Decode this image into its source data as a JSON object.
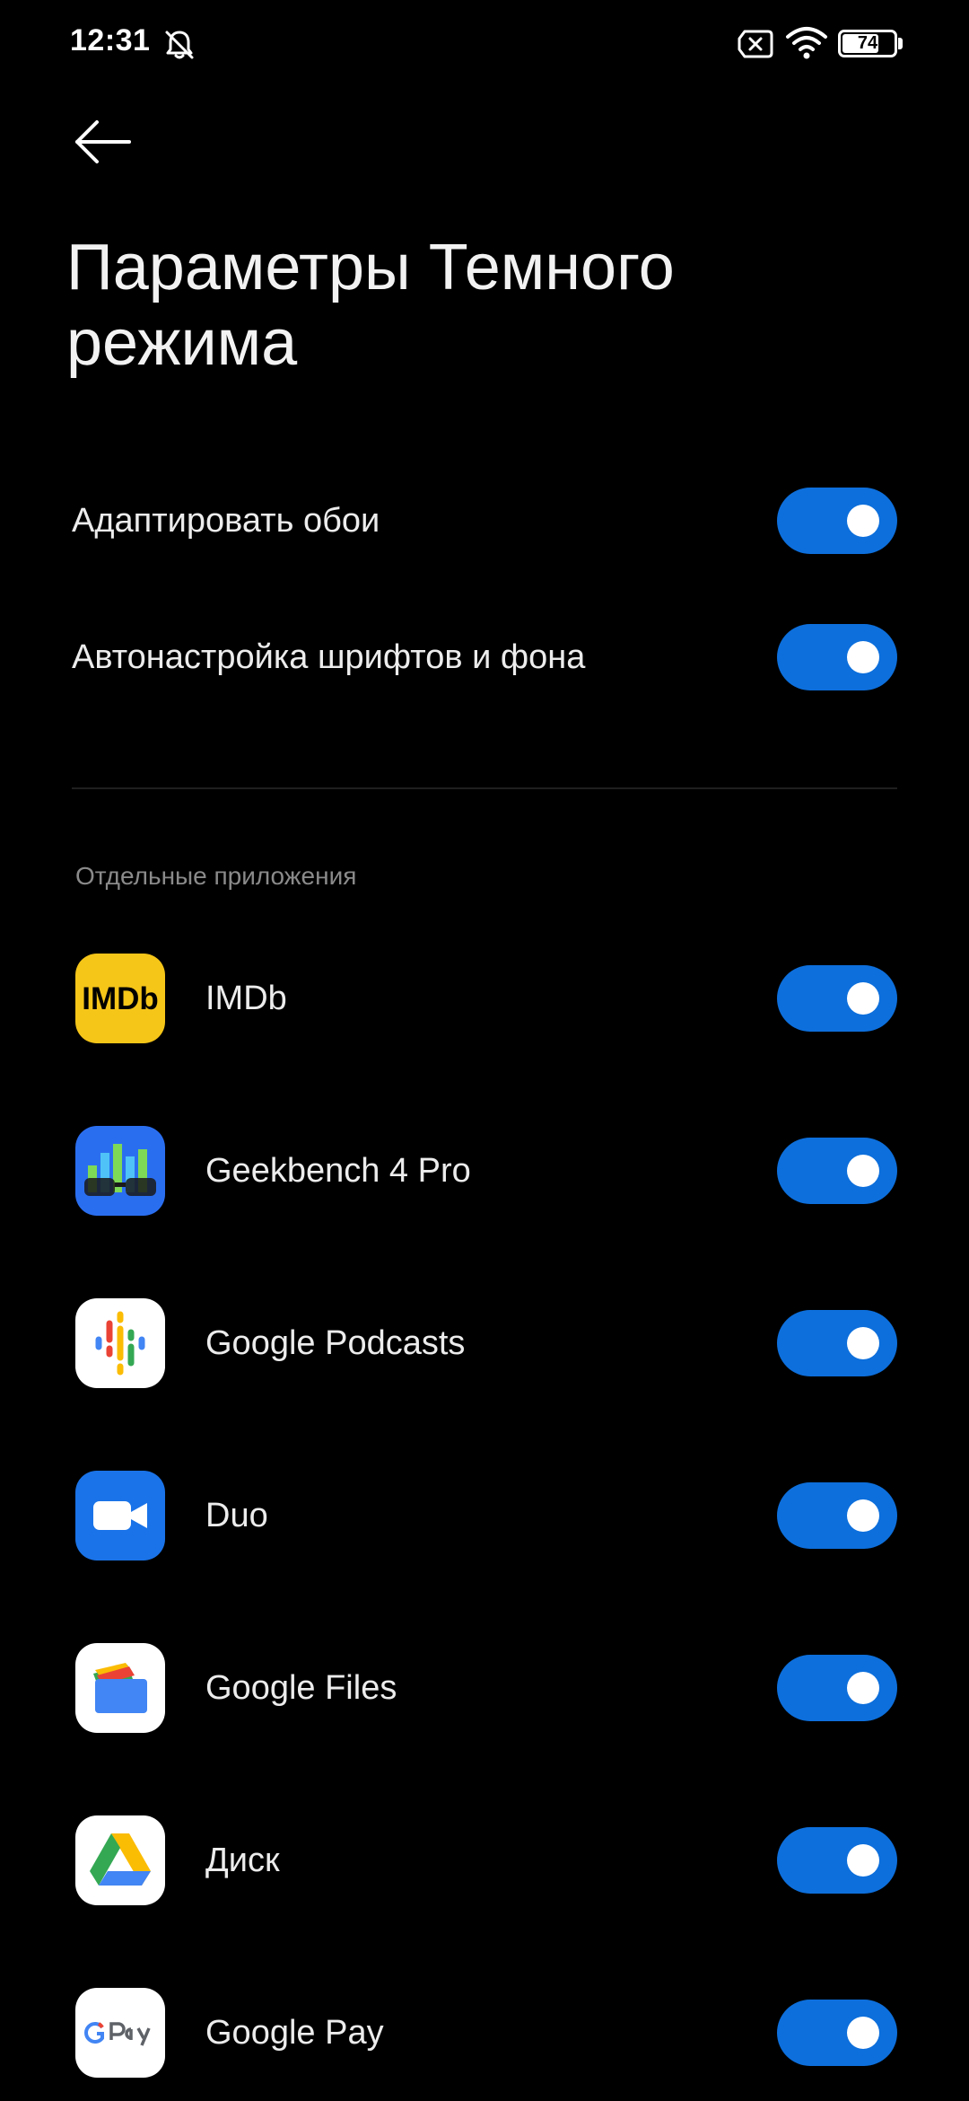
{
  "status_bar": {
    "time": "12:31",
    "battery_level": "74",
    "battery_fraction": 0.74,
    "icons": [
      "bell-muted-icon",
      "sim-none-icon",
      "wifi-icon",
      "battery-icon"
    ]
  },
  "header": {
    "back_icon": "arrow-left-icon",
    "title": "Параметры Темного режима"
  },
  "settings": [
    {
      "label": "Адаптировать обои",
      "enabled": true
    },
    {
      "label": "Автонастройка шрифтов и фона",
      "enabled": true
    }
  ],
  "section": {
    "title": "Отдельные приложения"
  },
  "apps": [
    {
      "name": "IMDb",
      "icon": "imdb-icon",
      "enabled": true
    },
    {
      "name": "Geekbench 4 Pro",
      "icon": "geekbench-icon",
      "enabled": true
    },
    {
      "name": "Google Podcasts",
      "icon": "google-podcasts-icon",
      "enabled": true
    },
    {
      "name": "Duo",
      "icon": "duo-icon",
      "enabled": true
    },
    {
      "name": "Google Files",
      "icon": "google-files-icon",
      "enabled": true
    },
    {
      "name": "Диск",
      "icon": "google-drive-icon",
      "enabled": true
    },
    {
      "name": "Google Pay",
      "icon": "google-pay-icon",
      "enabled": true
    }
  ],
  "colors": {
    "background": "#000000",
    "toggle_on": "#0d6fdc",
    "text_primary": "#ececec",
    "text_secondary": "#8a8a8a"
  }
}
